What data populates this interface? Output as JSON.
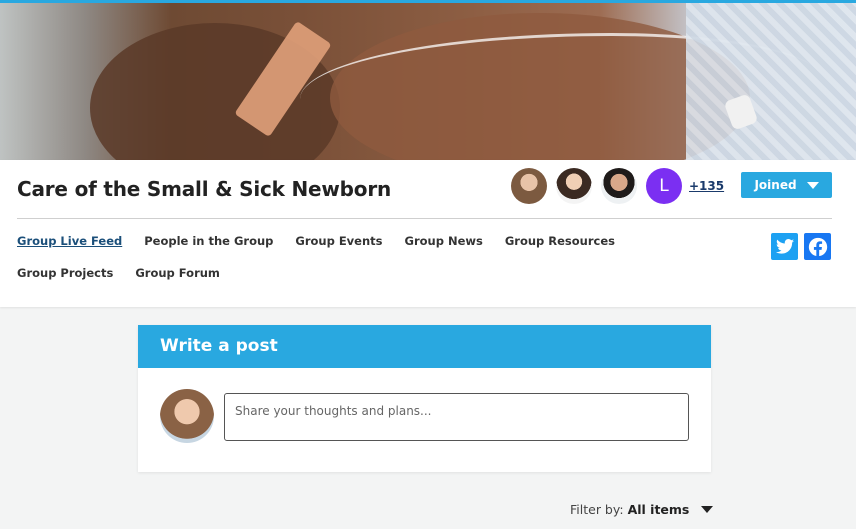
{
  "group": {
    "title": "Care of the Small & Sick Newborn",
    "member_more_count": "+135",
    "member_initial": "L",
    "joined_label": "Joined"
  },
  "nav": {
    "row1": [
      "Group Live Feed",
      "People in the Group",
      "Group Events",
      "Group News",
      "Group Resources"
    ],
    "row2": [
      "Group Projects",
      "Group Forum"
    ],
    "active": "Group Live Feed"
  },
  "social": {
    "twitter_icon": "twitter-icon",
    "facebook_icon": "facebook-icon"
  },
  "post": {
    "heading": "Write a post",
    "placeholder": "Share your thoughts and plans..."
  },
  "filter": {
    "label": "Filter by:",
    "value": "All items"
  },
  "colors": {
    "accent": "#29a8e0",
    "avatar_purple": "#7b2ff2",
    "twitter": "#1da1f2",
    "facebook": "#1877f2",
    "link_active": "#1b4f7a"
  }
}
